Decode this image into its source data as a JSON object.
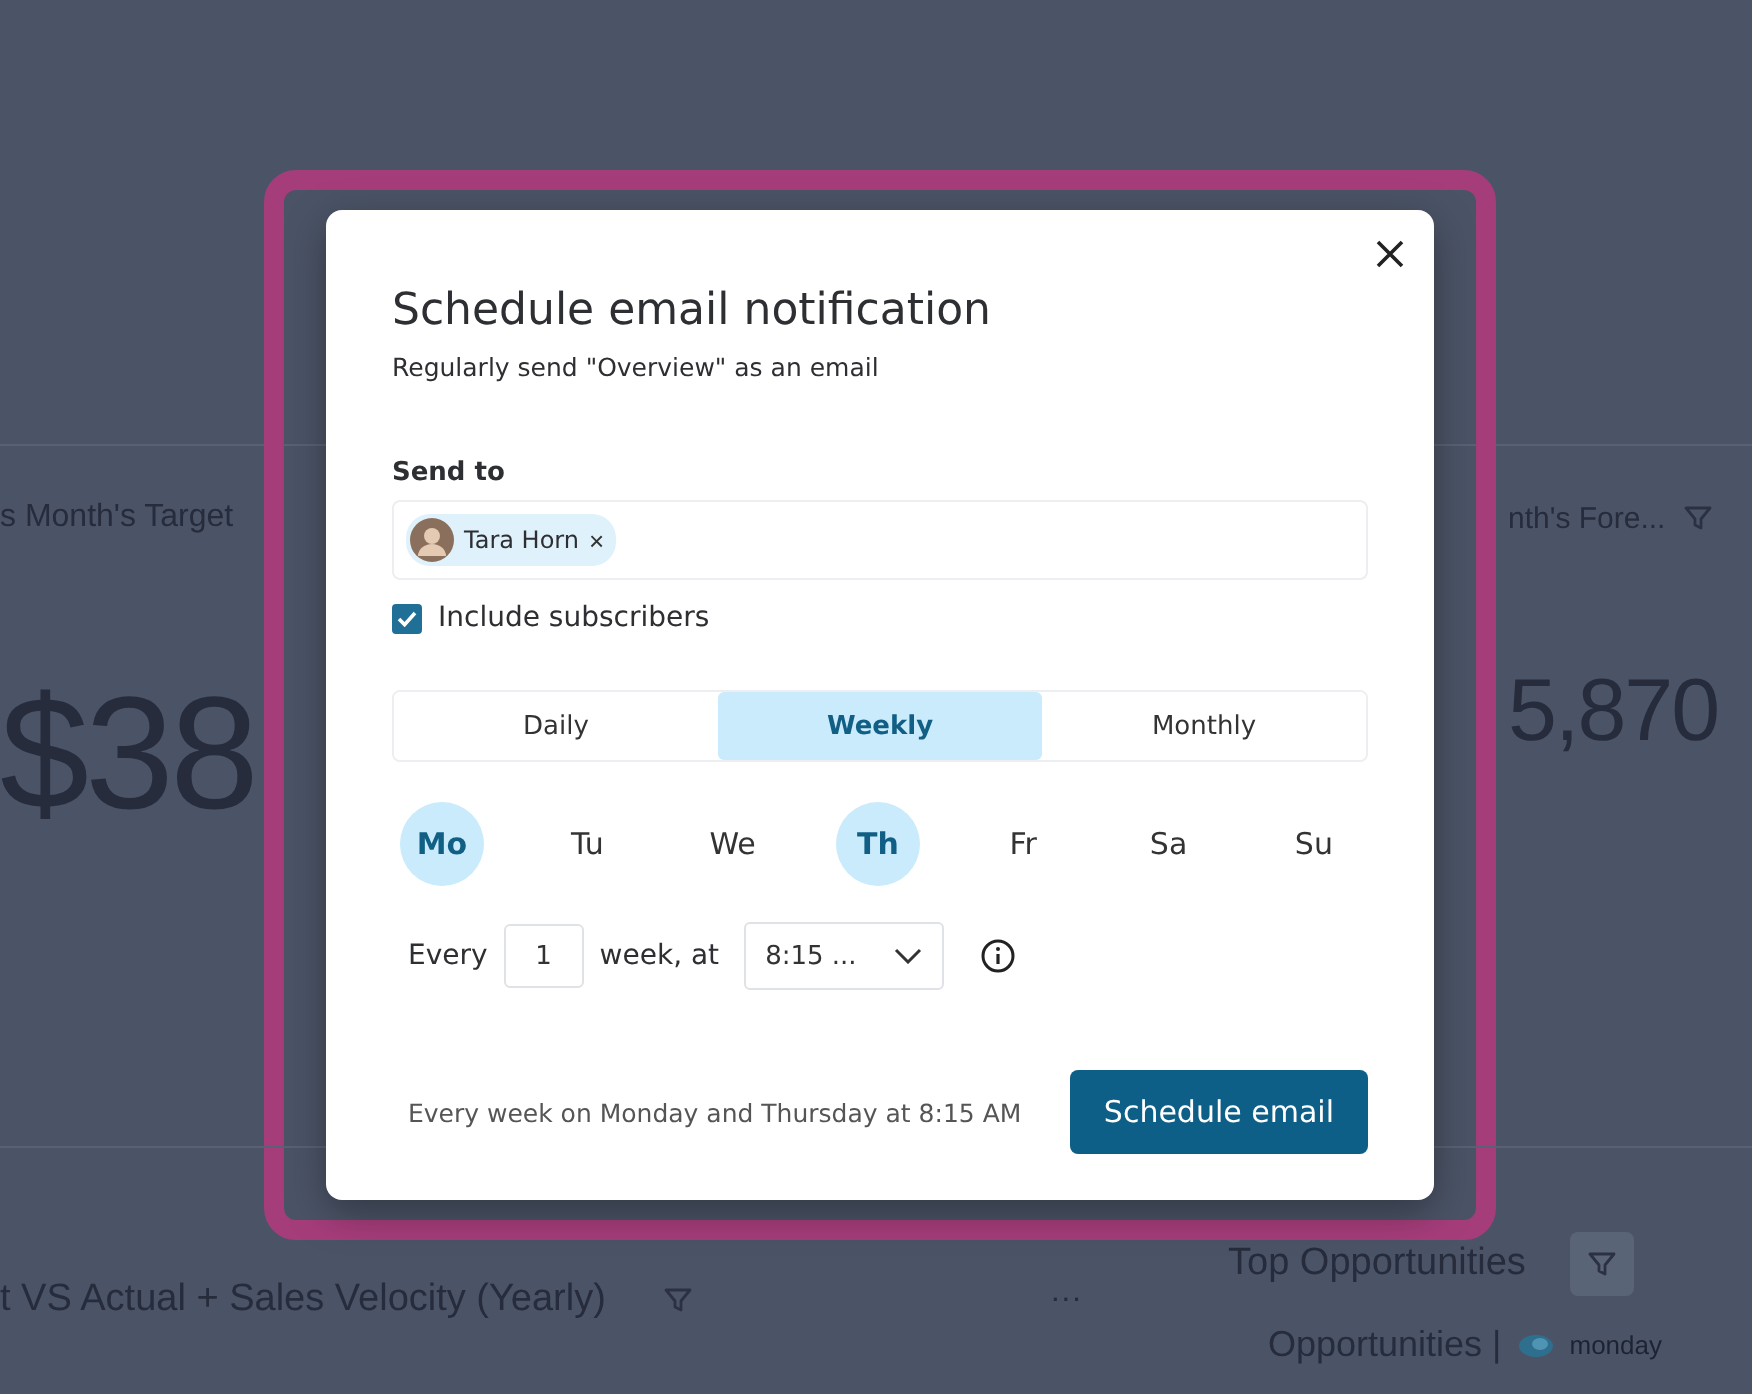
{
  "dashboard": {
    "kpi_cards": [
      {
        "title": "s Month's Target",
        "value": "$38",
        "filter": false
      },
      {
        "title": "nth's Fore...",
        "value": "5,870",
        "filter": true
      }
    ],
    "bottom_left": {
      "title": "t VS Actual + Sales Velocity (Yearly)",
      "more": "···"
    },
    "bottom_right": {
      "title": "Top Opportunities",
      "subtitle": "Opportunities |",
      "source": "monday"
    }
  },
  "dialog": {
    "title": "Schedule email notification",
    "subtitle": "Regularly send \"Overview\" as an email",
    "send_to_label": "Send to",
    "recipients": [
      {
        "name": "Tara Horn",
        "remove": "×"
      }
    ],
    "include_subscribers": {
      "label": "Include subscribers",
      "checked": true
    },
    "frequency": [
      {
        "label": "Daily",
        "selected": false
      },
      {
        "label": "Weekly",
        "selected": true
      },
      {
        "label": "Monthly",
        "selected": false
      }
    ],
    "days": [
      {
        "label": "Mo",
        "selected": true
      },
      {
        "label": "Tu",
        "selected": false
      },
      {
        "label": "We",
        "selected": false
      },
      {
        "label": "Th",
        "selected": true
      },
      {
        "label": "Fr",
        "selected": false
      },
      {
        "label": "Sa",
        "selected": false
      },
      {
        "label": "Su",
        "selected": false
      }
    ],
    "every_label": "Every",
    "interval": "1",
    "unit_label": "week, at",
    "time": "8:15 ...",
    "summary": "Every week on Monday and Thursday at 8:15 AM",
    "submit": "Schedule email"
  }
}
